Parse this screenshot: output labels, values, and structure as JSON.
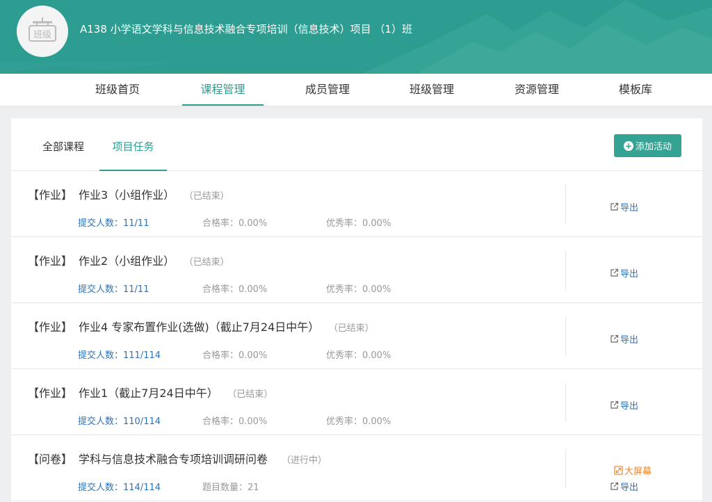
{
  "header": {
    "logo_text": "班级",
    "class_title": "A138 小学语文学科与信息技术融合专项培训（信息技术）项目 （1）班",
    "colors": {
      "primary": "#2e9d91"
    }
  },
  "nav": {
    "items": [
      {
        "label": "班级首页"
      },
      {
        "label": "课程管理",
        "active": true
      },
      {
        "label": "成员管理"
      },
      {
        "label": "班级管理"
      },
      {
        "label": "资源管理"
      },
      {
        "label": "模板库"
      }
    ]
  },
  "tabs": [
    {
      "label": "全部课程"
    },
    {
      "label": "项目任务",
      "active": true
    }
  ],
  "add_button": {
    "icon": "plus-circle-icon",
    "label": "添加活动"
  },
  "tasks": [
    {
      "type": "【作业】",
      "name": "作业3（小组作业）",
      "status": "（已结束）",
      "m1": "提交人数：11/11",
      "m2": "合格率：0.00%",
      "m3": "优秀率：0.00%",
      "export": "导出"
    },
    {
      "type": "【作业】",
      "name": "作业2（小组作业）",
      "status": "（已结束）",
      "m1": "提交人数：11/11",
      "m2": "合格率：0.00%",
      "m3": "优秀率：0.00%",
      "export": "导出"
    },
    {
      "type": "【作业】",
      "name": "作业4 专家布置作业(选做)（截止7月24日中午）",
      "status": "（已结束）",
      "m1": "提交人数：111/114",
      "m2": "合格率：0.00%",
      "m3": "优秀率：0.00%",
      "export": "导出"
    },
    {
      "type": "【作业】",
      "name": "作业1（截止7月24日中午）",
      "status": "（已结束）",
      "m1": "提交人数：110/114",
      "m2": "合格率：0.00%",
      "m3": "优秀率：0.00%",
      "export": "导出"
    },
    {
      "type": "【问卷】",
      "name": "学科与信息技术融合专项培训调研问卷",
      "status": "（进行中）",
      "m1": "提交人数：114/114",
      "m2": "题目数量：21",
      "big_screen": "大屏幕",
      "export": "导出"
    }
  ]
}
